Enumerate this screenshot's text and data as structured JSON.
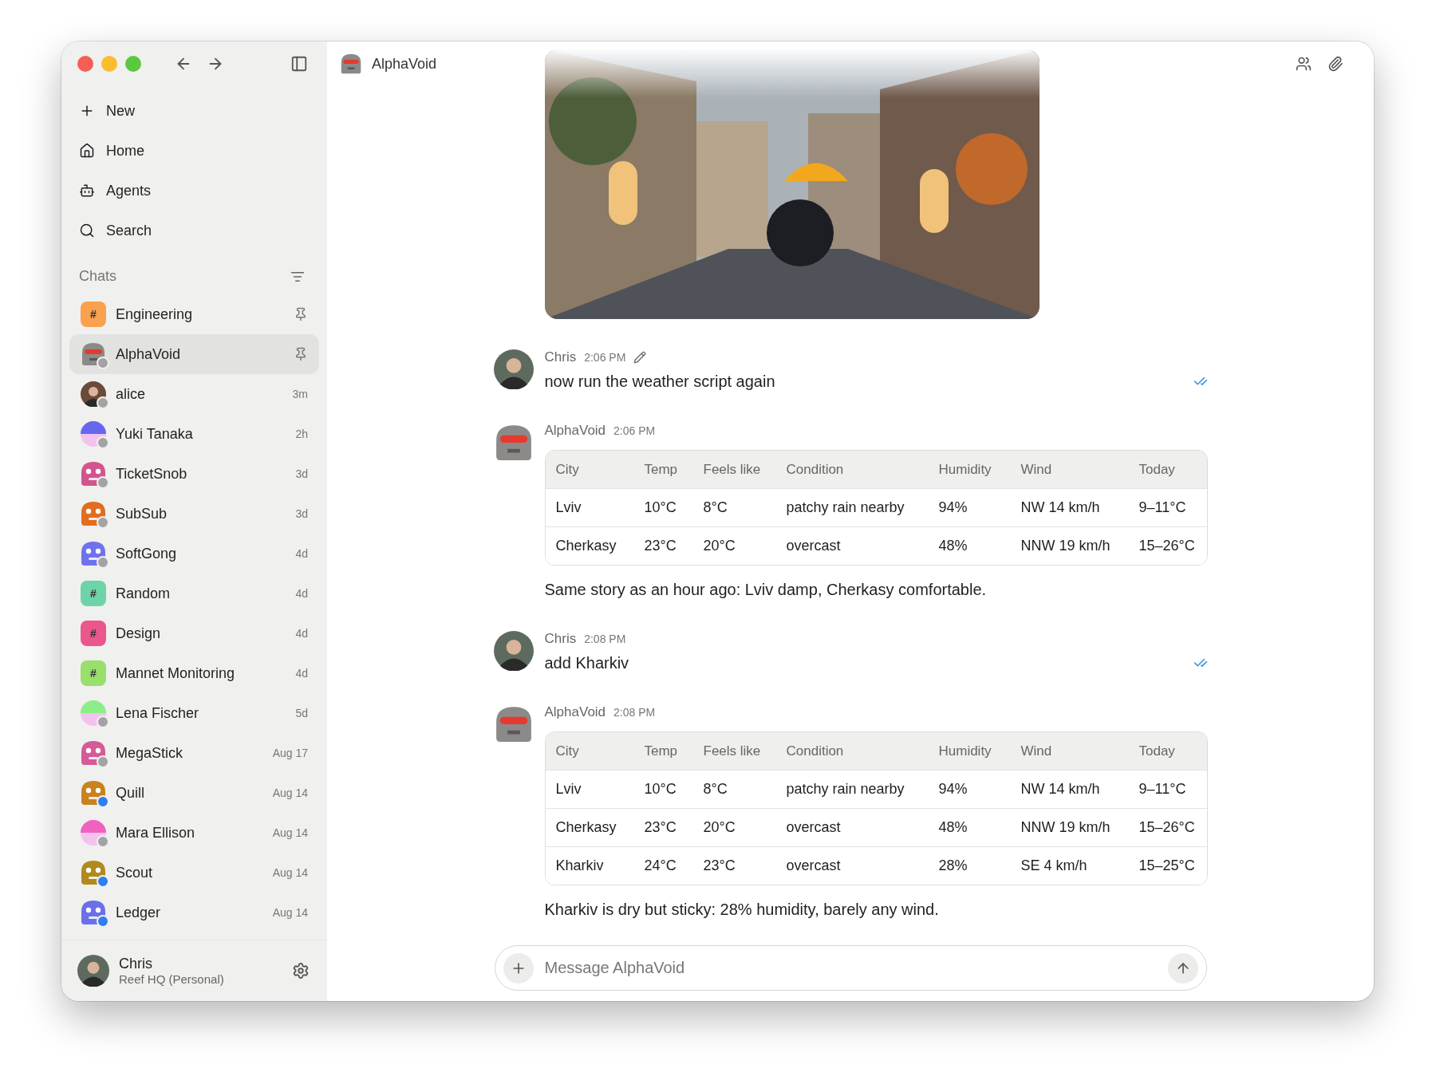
{
  "sidebar": {
    "nav": [
      {
        "kind": "plus",
        "label": "New"
      },
      {
        "kind": "home",
        "label": "Home"
      },
      {
        "kind": "bot",
        "label": "Agents"
      },
      {
        "kind": "search",
        "label": "Search"
      }
    ],
    "chats_header": "Chats",
    "chats": [
      {
        "name": "Engineering",
        "pinned": true,
        "selected": false,
        "avatar": {
          "kind": "channel",
          "glyph": "#",
          "color": "#f9a14e"
        }
      },
      {
        "name": "AlphaVoid",
        "pinned": true,
        "selected": true,
        "avatar": {
          "kind": "robot"
        },
        "status": {
          "color": "#a3a3a3"
        }
      },
      {
        "name": "alice",
        "time": "3m",
        "pinned": false,
        "selected": false,
        "avatar": {
          "kind": "person",
          "color": "#6b4a3a"
        },
        "status": {
          "color": "#a3a3a3"
        }
      },
      {
        "name": "Yuki Tanaka",
        "time": "2h",
        "pinned": false,
        "selected": false,
        "avatar": {
          "kind": "gradient",
          "color": "#6667ee"
        },
        "status": {
          "color": "#a3a3a3"
        }
      },
      {
        "name": "TicketSnob",
        "time": "3d",
        "pinned": false,
        "selected": false,
        "avatar": {
          "kind": "blob",
          "color": "#d2558e"
        },
        "status": {
          "color": "#a3a3a3"
        }
      },
      {
        "name": "SubSub",
        "time": "3d",
        "pinned": false,
        "selected": false,
        "avatar": {
          "kind": "blob",
          "color": "#e26c1f"
        },
        "status": {
          "color": "#a3a3a3"
        }
      },
      {
        "name": "SoftGong",
        "time": "4d",
        "pinned": false,
        "selected": false,
        "avatar": {
          "kind": "blob",
          "color": "#6f72ee"
        },
        "status": {
          "color": "#a3a3a3"
        }
      },
      {
        "name": "Random",
        "time": "4d",
        "pinned": false,
        "selected": false,
        "avatar": {
          "kind": "channel",
          "glyph": "#",
          "color": "#6fd3aa"
        }
      },
      {
        "name": "Design",
        "time": "4d",
        "pinned": false,
        "selected": false,
        "avatar": {
          "kind": "channel",
          "glyph": "#",
          "color": "#e9578c"
        }
      },
      {
        "name": "Mannet Monitoring",
        "time": "4d",
        "pinned": false,
        "selected": false,
        "avatar": {
          "kind": "channel",
          "glyph": "#",
          "color": "#9ade6c"
        }
      },
      {
        "name": "Lena Fischer",
        "time": "5d",
        "pinned": false,
        "selected": false,
        "avatar": {
          "kind": "gradient",
          "color": "#8cef86"
        },
        "status": {
          "color": "#a3a3a3"
        }
      },
      {
        "name": "MegaStick",
        "time": "Aug 17",
        "pinned": false,
        "selected": false,
        "avatar": {
          "kind": "blob",
          "color": "#d65a98"
        },
        "status": {
          "color": "#a3a3a3"
        }
      },
      {
        "name": "Quill",
        "time": "Aug 14",
        "pinned": false,
        "selected": false,
        "avatar": {
          "kind": "blob",
          "color": "#c9821c"
        },
        "status": {
          "color": "#2f7ff0"
        }
      },
      {
        "name": "Mara Ellison",
        "time": "Aug 14",
        "pinned": false,
        "selected": false,
        "avatar": {
          "kind": "gradient",
          "color": "#ef62c0"
        },
        "status": {
          "color": "#a3a3a3"
        }
      },
      {
        "name": "Scout",
        "time": "Aug 14",
        "pinned": false,
        "selected": false,
        "avatar": {
          "kind": "blob",
          "color": "#b08a1e"
        },
        "status": {
          "color": "#2f7ff0"
        }
      },
      {
        "name": "Ledger",
        "time": "Aug 14",
        "pinned": false,
        "selected": false,
        "avatar": {
          "kind": "blob",
          "color": "#6b70e8"
        },
        "status": {
          "color": "#2f7ff0"
        }
      }
    ],
    "user": {
      "name": "Chris",
      "workspace": "Reef HQ (Personal)"
    }
  },
  "conversation": {
    "title": "AlphaVoid",
    "messages": [
      {
        "kind": "picture"
      },
      {
        "kind": "message",
        "author": "Chris",
        "avatar": {
          "kind": "person"
        },
        "time": "2:06 PM",
        "edited": true,
        "read": true,
        "text": "now run the weather script again"
      },
      {
        "kind": "message",
        "author": "AlphaVoid",
        "avatar": {
          "kind": "robot"
        },
        "time": "2:06 PM",
        "edited": false,
        "read": false,
        "table": {
          "columns": [
            "City",
            "Temp",
            "Feels like",
            "Condition",
            "Humidity",
            "Wind",
            "Today"
          ],
          "rows": [
            [
              "Lviv",
              "10°C",
              "8°C",
              "patchy rain nearby",
              "94%",
              "NW 14 km/h",
              "9–11°C"
            ],
            [
              "Cherkasy",
              "23°C",
              "20°C",
              "overcast",
              "48%",
              "NNW 19 km/h",
              "15–26°C"
            ]
          ]
        },
        "text": "Same story as an hour ago: Lviv damp, Cherkasy comfortable."
      },
      {
        "kind": "message",
        "author": "Chris",
        "avatar": {
          "kind": "person"
        },
        "time": "2:08 PM",
        "edited": false,
        "read": true,
        "text": "add Kharkiv"
      },
      {
        "kind": "message",
        "author": "AlphaVoid",
        "avatar": {
          "kind": "robot"
        },
        "time": "2:08 PM",
        "edited": false,
        "read": false,
        "table": {
          "columns": [
            "City",
            "Temp",
            "Feels like",
            "Condition",
            "Humidity",
            "Wind",
            "Today"
          ],
          "rows": [
            [
              "Lviv",
              "10°C",
              "8°C",
              "patchy rain nearby",
              "94%",
              "NW 14 km/h",
              "9–11°C"
            ],
            [
              "Cherkasy",
              "23°C",
              "20°C",
              "overcast",
              "48%",
              "NNW 19 km/h",
              "15–26°C"
            ],
            [
              "Kharkiv",
              "24°C",
              "23°C",
              "overcast",
              "28%",
              "SE 4 km/h",
              "15–25°C"
            ]
          ]
        },
        "text": "Kharkiv is dry but sticky: 28% humidity, barely any wind."
      }
    ],
    "composer": {
      "placeholder": "Message AlphaVoid"
    }
  }
}
